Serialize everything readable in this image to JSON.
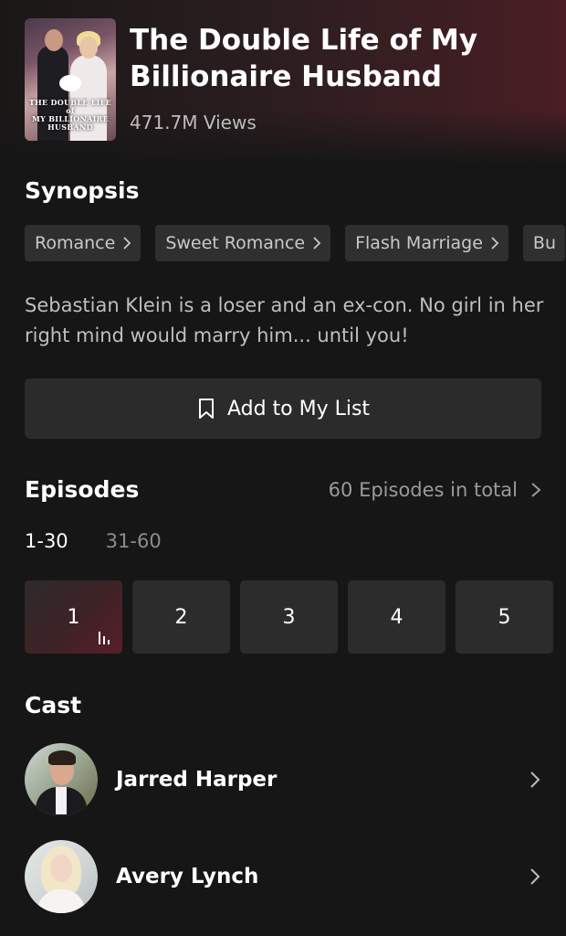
{
  "show": {
    "title": "The Double Life of My Billionaire Husband",
    "views": "471.7M Views",
    "poster_title": "THE DOUBLE LIFE of MY BILLIONAIRE HUSBAND"
  },
  "synopsis": {
    "heading": "Synopsis",
    "tags": [
      "Romance",
      "Sweet Romance",
      "Flash Marriage",
      "Bu"
    ],
    "text": "Sebastian Klein is a loser and an ex-con. No girl in her right mind would marry him... until you!"
  },
  "actions": {
    "add_to_list": "Add to My List"
  },
  "episodes": {
    "heading": "Episodes",
    "total": "60 Episodes in total",
    "ranges": [
      "1-30",
      "31-60"
    ],
    "active_range": "1-30",
    "items": [
      "1",
      "2",
      "3",
      "4",
      "5"
    ],
    "playing": "1"
  },
  "cast": {
    "heading": "Cast",
    "members": [
      {
        "name": "Jarred Harper"
      },
      {
        "name": "Avery Lynch"
      }
    ]
  },
  "colors": {
    "background": "#161616",
    "surface": "#2c2c2c",
    "accent": "#5a1e28"
  }
}
